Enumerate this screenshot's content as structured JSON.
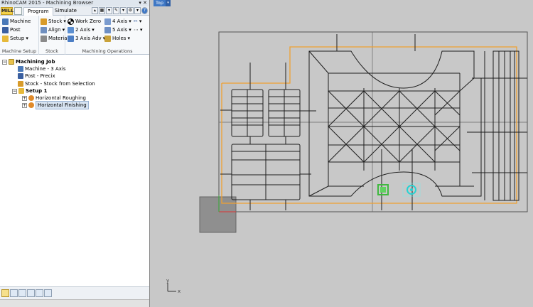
{
  "window": {
    "title": "RhinoCAM 2015 - Machining Browser",
    "controls": "▾ ✕"
  },
  "tabs": {
    "mill": "MILL",
    "program": "Program",
    "simulate": "Simulate"
  },
  "ribbon": {
    "machine_setup": {
      "label": "Machine Setup",
      "machine": "Machine",
      "post": "Post",
      "setup": "Setup"
    },
    "stock": {
      "label": "Stock",
      "stock": "Stock",
      "align": "Align",
      "material": "Material"
    },
    "machining_operations": {
      "label": "Machining Operations",
      "work_zero": "Work Zero",
      "two_axis": "2 Axis",
      "three_axis_adv": "3 Axis Adv",
      "four_axis": "4 Axis",
      "five_axis": "5 Axis",
      "holes": "Holes"
    }
  },
  "tree": {
    "root": "Machining Job",
    "machine": "Machine - 3 Axis",
    "post": "Post - Precix",
    "stock": "Stock - Stock from Selection",
    "setup": "Setup 1",
    "op1": "Horizontal Roughing",
    "op2": "Horizontal Finishing"
  },
  "viewport": {
    "view_name": "Top",
    "axis_x": "x",
    "axis_y": "y"
  },
  "colors": {
    "toolpath": "#f0a030",
    "geometry": "#1e1e1e",
    "stock_box": "#555555",
    "selection": "#3fb93f",
    "cyan": "#27d3d3"
  }
}
